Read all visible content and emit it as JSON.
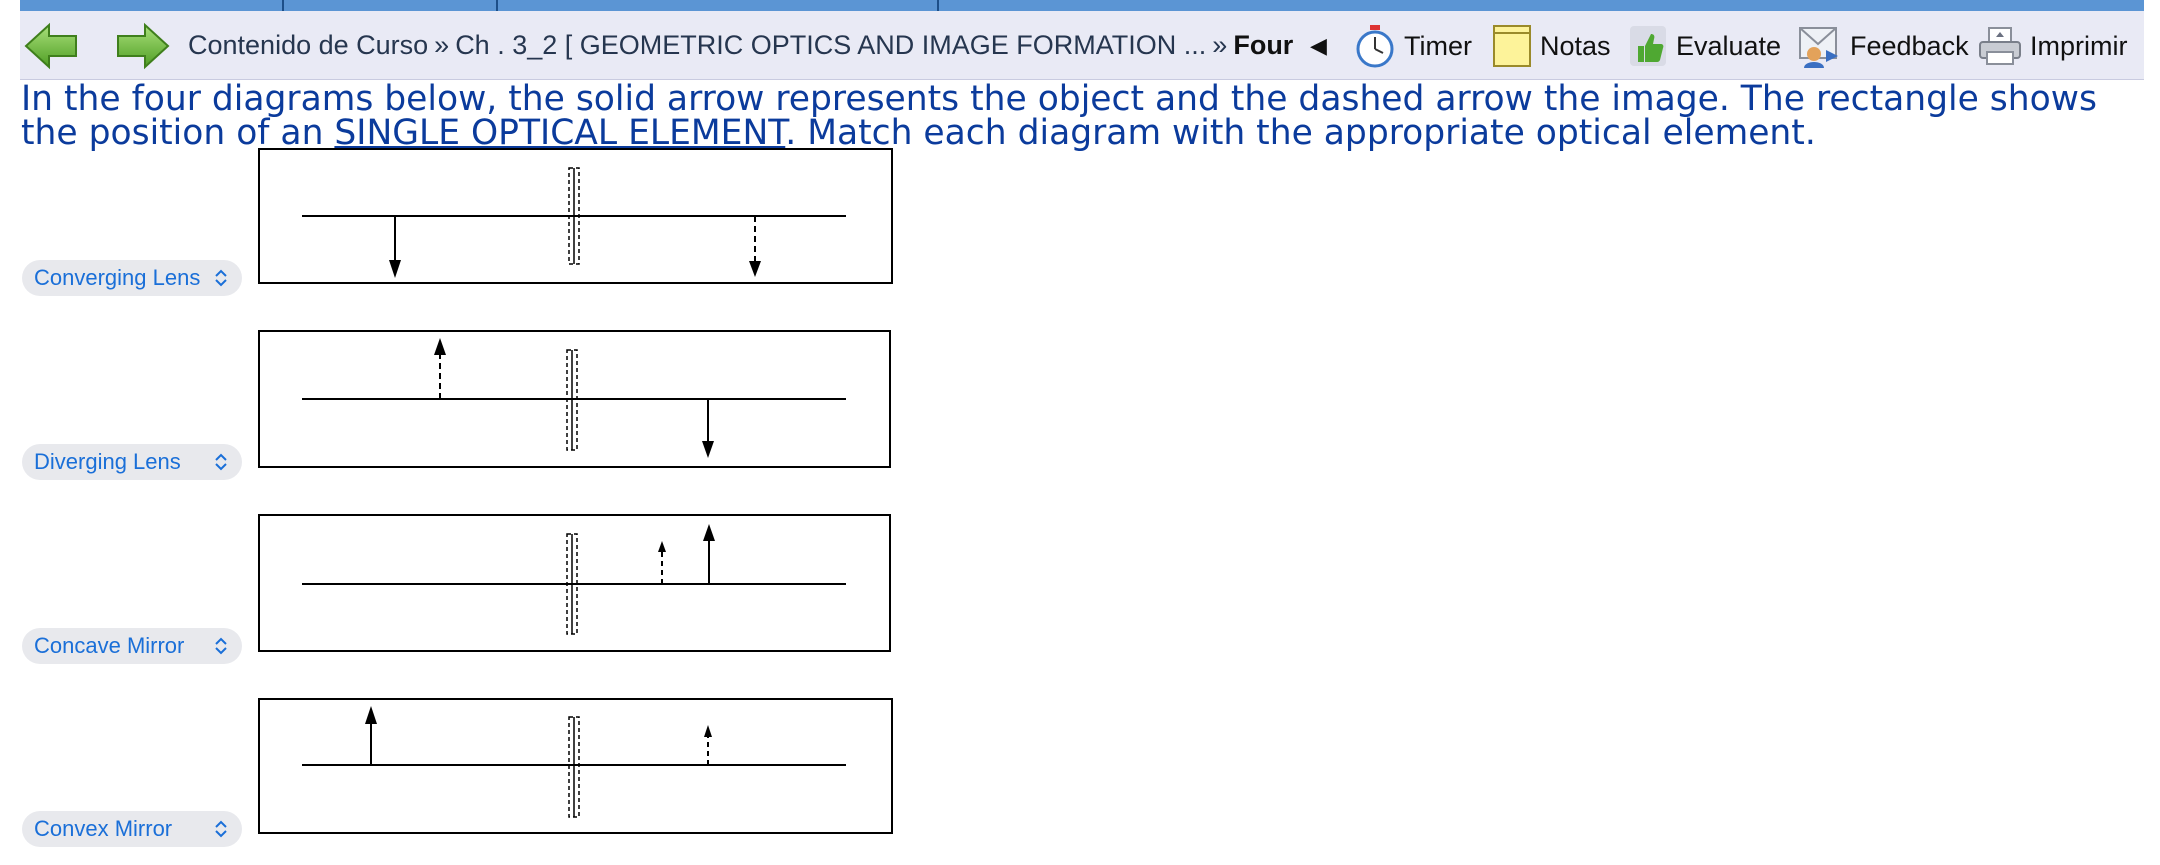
{
  "toolbar": {
    "breadcrumb": {
      "root": "Contenido de Curso",
      "separator": "»",
      "chapter": "Ch . 3_2 [ GEOMETRIC OPTICS AND IMAGE FORMATION ...",
      "current": "Four"
    },
    "prev_symbol": "◀",
    "timer": "Timer",
    "notes": "Notas",
    "evaluate": "Evaluate",
    "feedback": "Feedback",
    "print": "Imprimir"
  },
  "question": {
    "part1": "In the four diagrams below, the solid arrow represents the object and the dashed arrow the image. The rectangle shows the position of an ",
    "underlined": "SINGLE OPTICAL ELEMENT",
    "part2": ". Match each diagram with the appropriate optical element."
  },
  "answers": [
    {
      "selected": "Converging Lens"
    },
    {
      "selected": "Diverging Lens"
    },
    {
      "selected": "Concave Mirror"
    },
    {
      "selected": "Convex Mirror"
    }
  ],
  "colors": {
    "accent_blue": "#1a6fd8",
    "question_text": "#0b3b9c",
    "toolbar_bg": "#e9eaf5",
    "top_strip": "#5b95d4",
    "nav_arrow_green": "#6cbf3a"
  }
}
